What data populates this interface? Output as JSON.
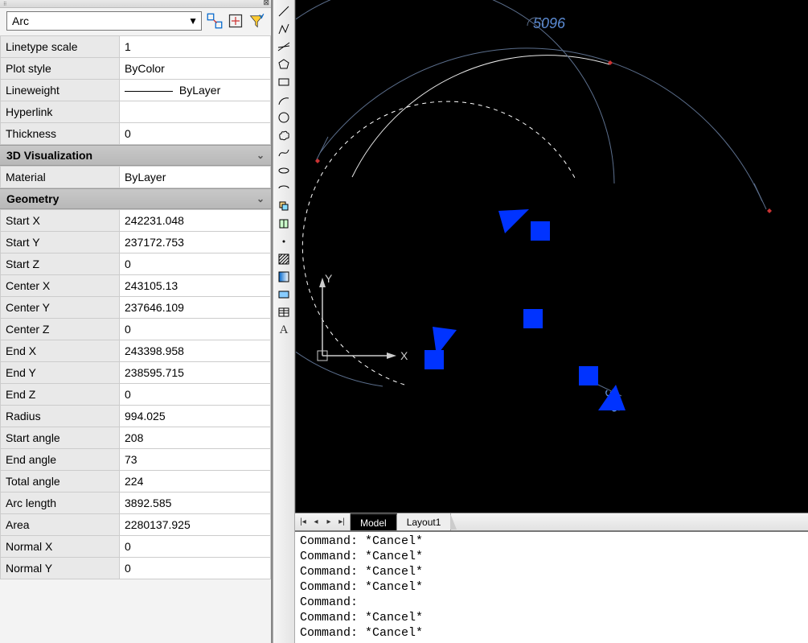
{
  "selector": {
    "label": "Arc"
  },
  "general_rows": [
    {
      "k": "Linetype scale",
      "v": "1"
    },
    {
      "k": "Plot style",
      "v": "ByColor"
    },
    {
      "k": "Lineweight",
      "v": "ByLayer",
      "linewsample": true
    },
    {
      "k": "Hyperlink",
      "v": ""
    },
    {
      "k": "Thickness",
      "v": "0"
    }
  ],
  "section_vis": "3D Visualization",
  "vis_rows": [
    {
      "k": "Material",
      "v": "ByLayer"
    }
  ],
  "section_geo": "Geometry",
  "geo_rows": [
    {
      "k": "Start X",
      "v": "242231.048"
    },
    {
      "k": "Start Y",
      "v": "237172.753"
    },
    {
      "k": "Start Z",
      "v": "0"
    },
    {
      "k": "Center X",
      "v": "243105.13"
    },
    {
      "k": "Center Y",
      "v": "237646.109"
    },
    {
      "k": "Center Z",
      "v": "0"
    },
    {
      "k": "End X",
      "v": "243398.958"
    },
    {
      "k": "End Y",
      "v": "238595.715"
    },
    {
      "k": "End Z",
      "v": "0"
    },
    {
      "k": "Radius",
      "v": "994.025"
    },
    {
      "k": "Start angle",
      "v": "208"
    },
    {
      "k": "End angle",
      "v": "73"
    },
    {
      "k": "Total angle",
      "v": "224"
    },
    {
      "k": "Arc length",
      "v": "3892.585"
    },
    {
      "k": "Area",
      "v": "2280137.925"
    },
    {
      "k": "Normal X",
      "v": "0"
    },
    {
      "k": "Normal Y",
      "v": "0"
    }
  ],
  "tabs": {
    "active": "Model",
    "layout": "Layout1"
  },
  "dim_label": "5096",
  "radius_label": "303",
  "ucs": {
    "x": "X",
    "y": "Y"
  },
  "cmd_lines": [
    "Command: *Cancel*",
    "Command: *Cancel*",
    "Command: *Cancel*",
    "Command: *Cancel*",
    "Command:",
    "Command: *Cancel*",
    "Command: *Cancel*"
  ]
}
